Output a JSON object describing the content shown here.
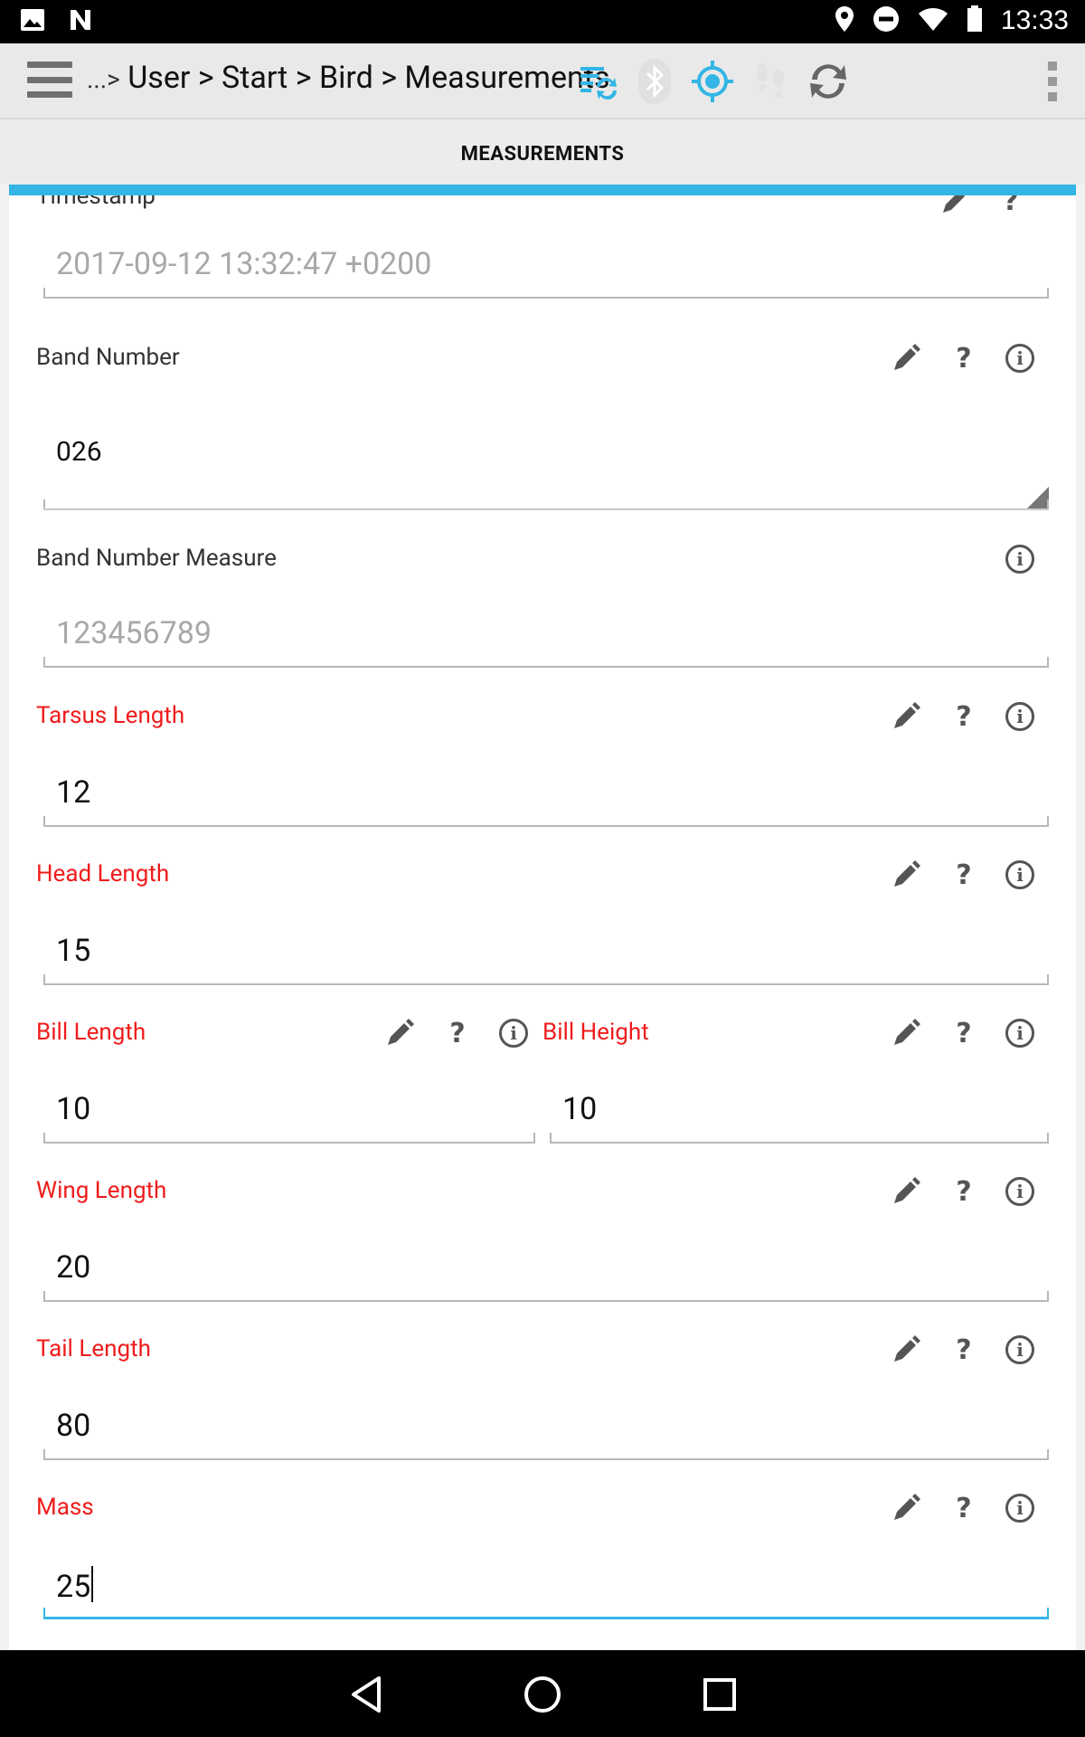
{
  "status": {
    "time": "13:33"
  },
  "header": {
    "ellipsis": "...>",
    "breadcrumb": "User > Start > Bird > Measurements"
  },
  "tab": {
    "title": "MEASUREMENTS"
  },
  "fields": {
    "timestamp": {
      "label": "Timestamp",
      "value": "2017-09-12 13:32:47 +0200"
    },
    "band_number": {
      "label": "Band Number",
      "value": "026"
    },
    "band_number_measure": {
      "label": "Band Number Measure",
      "value": "123456789"
    },
    "tarsus_length": {
      "label": "Tarsus Length",
      "value": "12"
    },
    "head_length": {
      "label": "Head Length",
      "value": "15"
    },
    "bill_length": {
      "label": "Bill Length",
      "value": "10"
    },
    "bill_height": {
      "label": "Bill Height",
      "value": "10"
    },
    "wing_length": {
      "label": "Wing Length",
      "value": "20"
    },
    "tail_length": {
      "label": "Tail Length",
      "value": "80"
    },
    "mass": {
      "label": "Mass",
      "value": "25"
    }
  },
  "icons": {
    "help": "?",
    "info": "i",
    "edit": "pencil-icon"
  },
  "colors": {
    "accent": "#33b5e5",
    "required_label": "#ef1c1c"
  }
}
